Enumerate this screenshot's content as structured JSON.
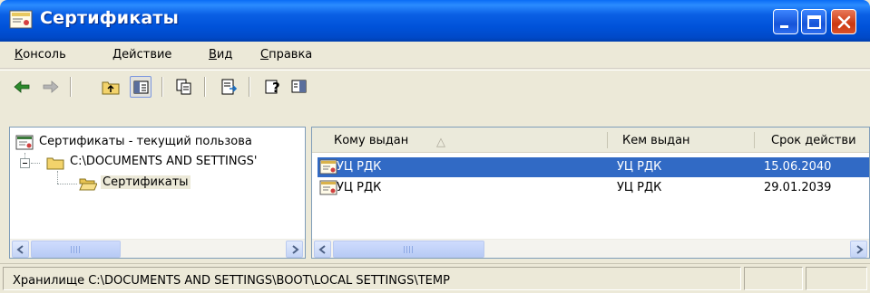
{
  "window": {
    "title": "Сертификаты"
  },
  "menu": [
    {
      "accel": "К",
      "rest": "онсоль"
    },
    {
      "accel": "Д",
      "rest": "ействие"
    },
    {
      "accel": "В",
      "rest": "ид"
    },
    {
      "accel": "С",
      "rest": "правка"
    }
  ],
  "toolbar": {
    "icons": [
      "back-arrow-icon",
      "forward-arrow-icon",
      "up-folder-icon",
      "show-tree-icon",
      "copy-icon",
      "export-list-icon",
      "help-icon",
      "action-pane-icon"
    ]
  },
  "tree": {
    "root": "Сертификаты - текущий пользова",
    "child": "C:\\DOCUMENTS AND SETTINGS'",
    "leaf": "Сертификаты"
  },
  "list": {
    "columns": [
      "Кому выдан",
      "Кем выдан",
      "Срок действи"
    ],
    "sort_arrow": "△",
    "rows": [
      {
        "issued_to": "УЦ РДК",
        "issued_by": "УЦ РДК",
        "expires": "15.06.2040"
      },
      {
        "issued_to": "УЦ РДК",
        "issued_by": "УЦ РДК",
        "expires": "29.01.2039"
      }
    ]
  },
  "status": {
    "text": "Хранилище C:\\DOCUMENTS AND SETTINGS\\BOOT\\LOCAL SETTINGS\\TEMP"
  },
  "colors": {
    "titlebar": "#0052d9",
    "selection": "#316ac5",
    "face": "#ece9d8"
  }
}
